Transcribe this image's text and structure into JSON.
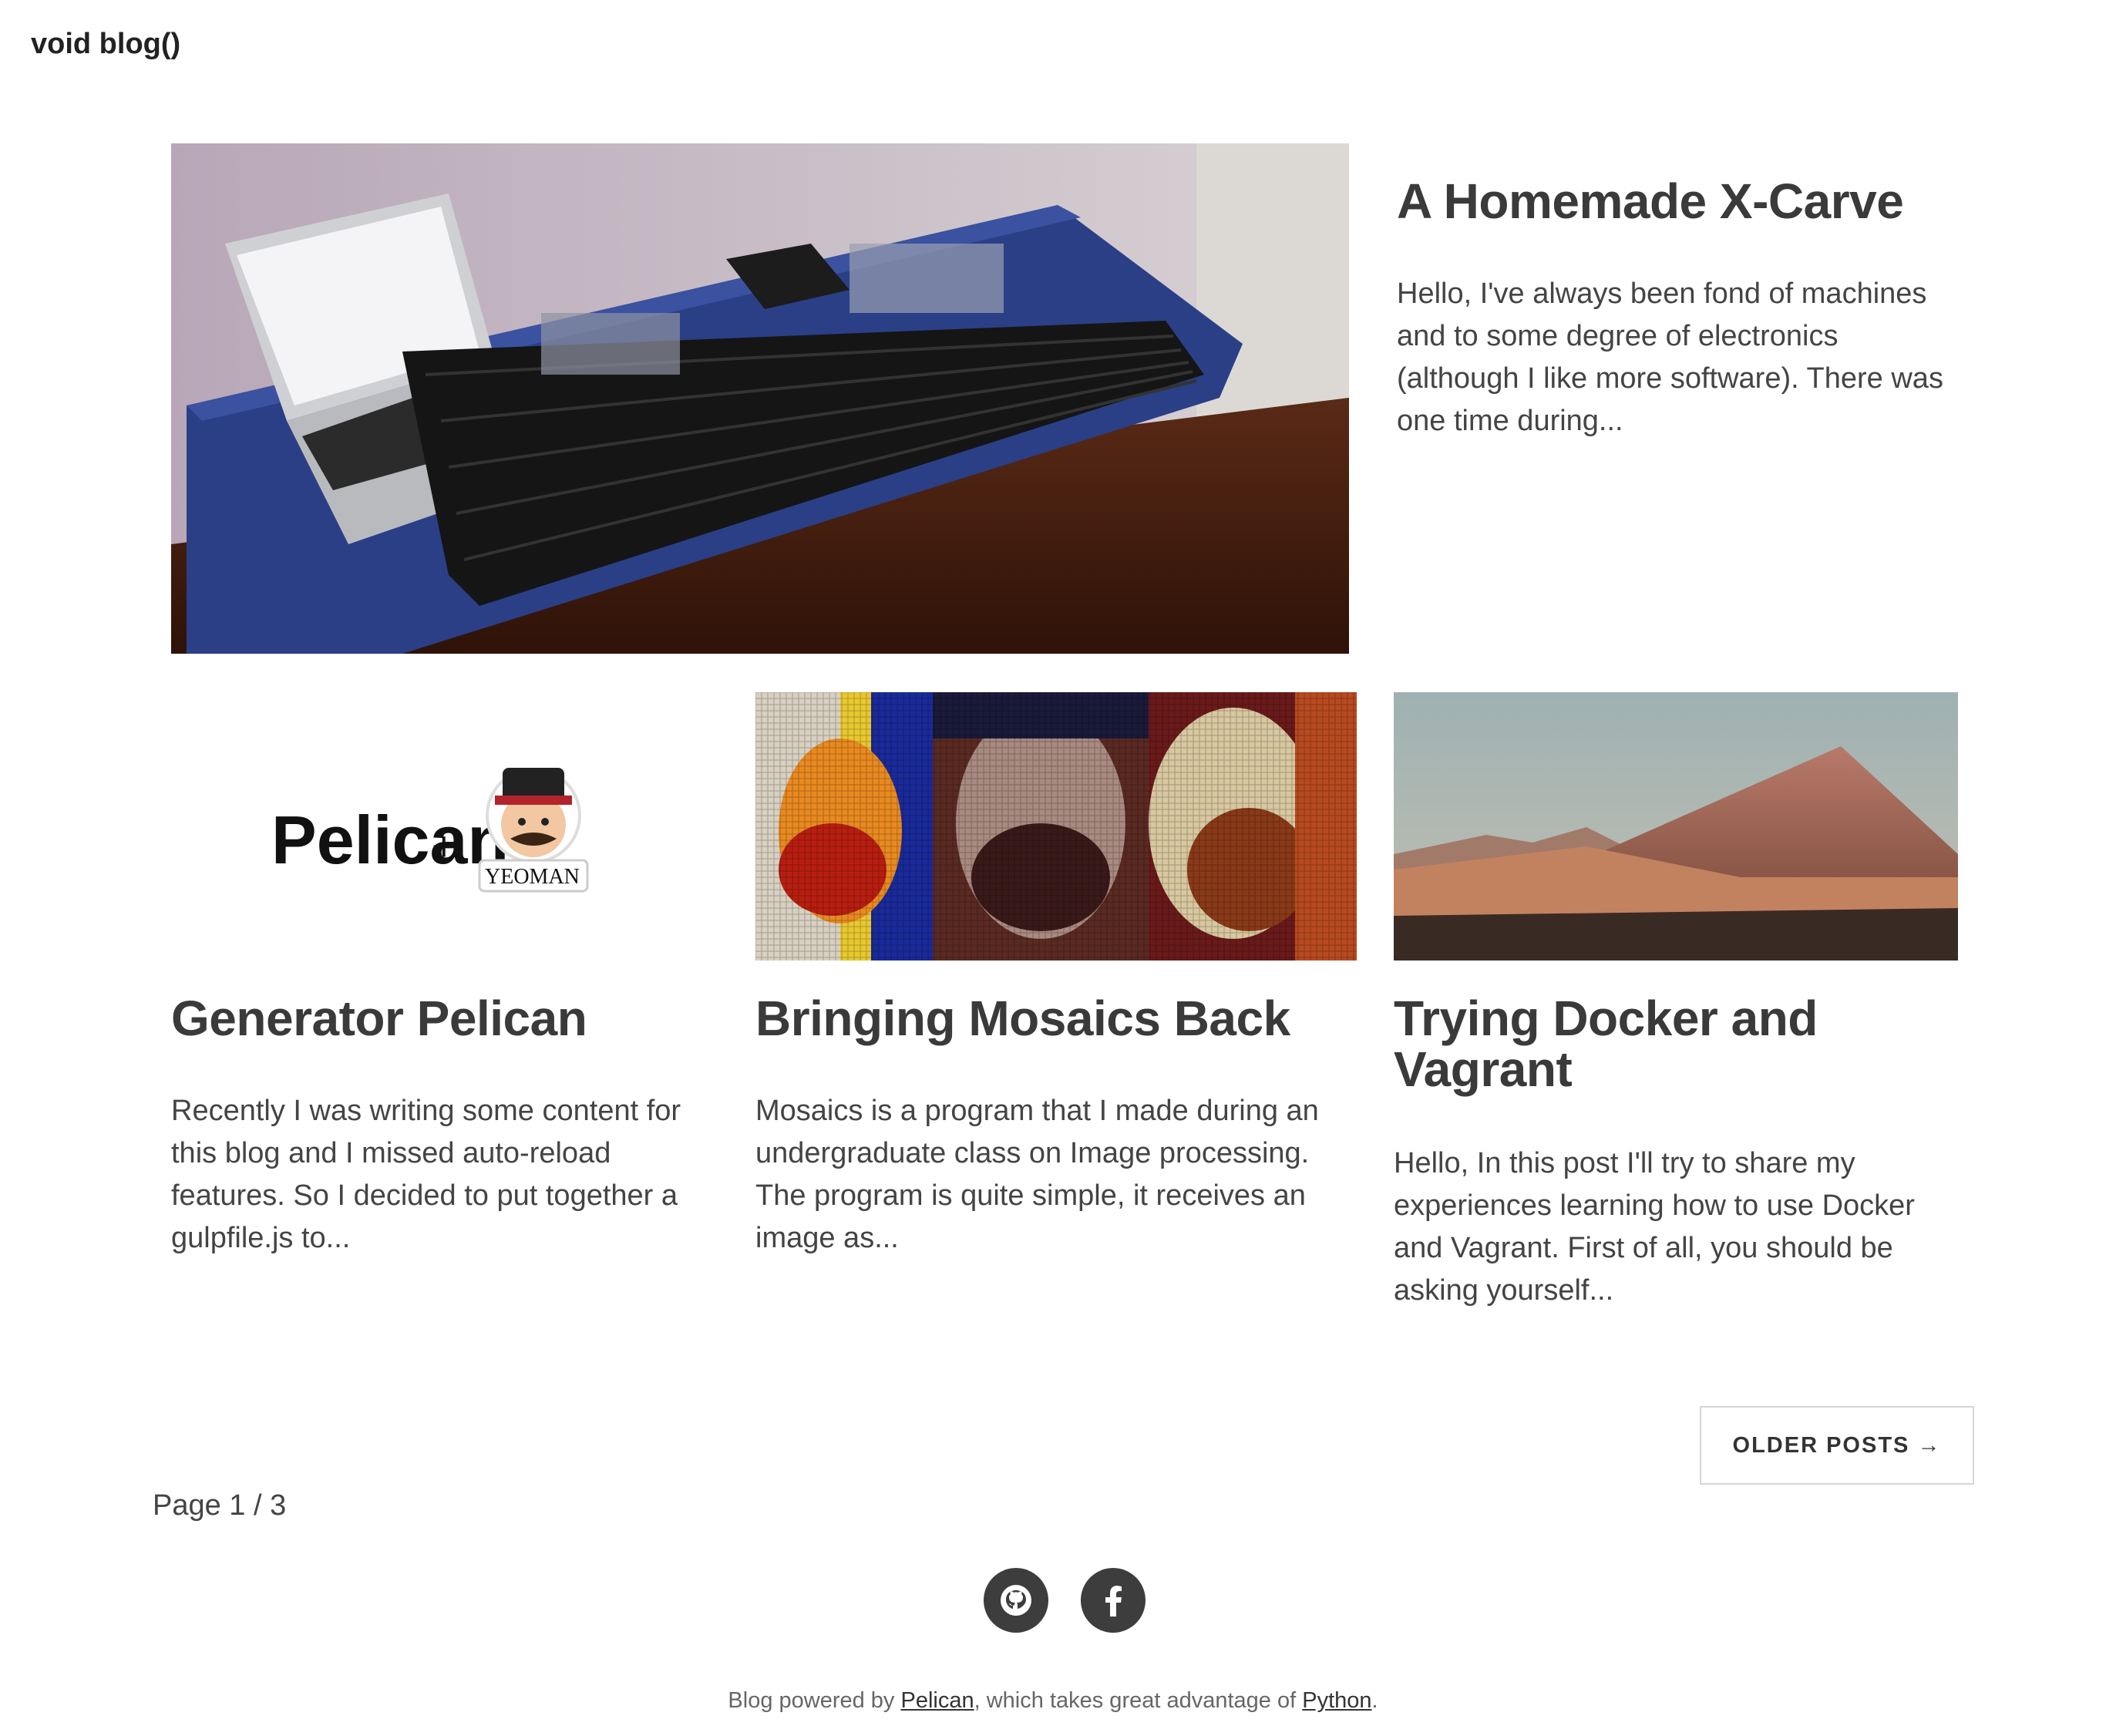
{
  "site": {
    "title": "void blog()"
  },
  "posts": [
    {
      "title": "A Homemade X-Carve",
      "excerpt": "Hello, I've always been fond of machines and to some degree of electronics (although I like more software). There was one time during..."
    },
    {
      "title": "Generator Pelican",
      "excerpt": "Recently I was writing some content for this blog and I missed auto-reload features. So I decided to put together a gulpfile.js to..."
    },
    {
      "title": "Bringing Mosaics Back",
      "excerpt": "Mosaics is a program that I made during an undergraduate class on Image processing. The program is quite simple, it receives an image as..."
    },
    {
      "title": "Trying Docker and Vagrant",
      "excerpt": "Hello, In this post I'll try to share my experiences learning how to use Docker and Vagrant. First of all, you should be asking yourself..."
    }
  ],
  "thumbs": {
    "pelican_logo_text": "Pelican",
    "plus": "+",
    "yeoman_text": "YEOMAN"
  },
  "pagination": {
    "older_label": "OLDER POSTS →",
    "page_info": "Page 1 / 3"
  },
  "social": [
    {
      "icon": "github-icon"
    },
    {
      "icon": "facebook-icon"
    }
  ],
  "footer": {
    "prefix": "Blog powered by ",
    "link1": "Pelican",
    "middle": ", which takes great advantage of ",
    "link2": "Python",
    "suffix": "."
  }
}
